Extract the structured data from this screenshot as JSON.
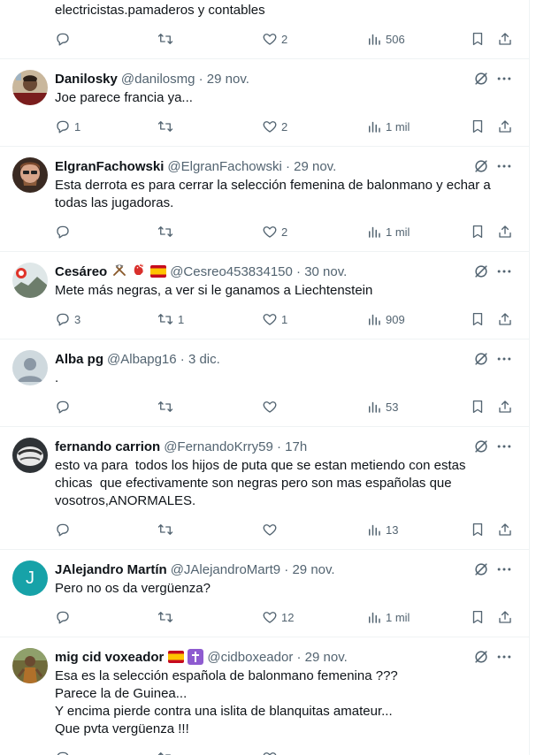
{
  "tweets": [
    {
      "text": "electricistas.pamaderos y contables",
      "counts": {
        "replies": "",
        "retweets": "",
        "likes": "2",
        "views": "506"
      }
    },
    {
      "name": "Danilosky",
      "handle": "@danilosmg · 29 nov.",
      "text": "Joe parece francia ya...",
      "counts": {
        "replies": "1",
        "retweets": "",
        "likes": "2",
        "views": "1 mil"
      }
    },
    {
      "name": "ElgranFachowski",
      "handle": "@ElgranFachowski · 29 nov.",
      "text": "Esta derrota es para cerrar la selección femenina de balonmano y echar a\ntodas las jugadoras.",
      "counts": {
        "replies": "",
        "retweets": "",
        "likes": "2",
        "views": "1 mil"
      }
    },
    {
      "name": "Cesáreo",
      "handle": "@Cesreo453834150 · 30 nov.",
      "text": "Mete más negras, a ver si le ganamos a Liechtenstein",
      "counts": {
        "replies": "3",
        "retweets": "1",
        "likes": "1",
        "views": "909"
      }
    },
    {
      "name": "Alba pg",
      "handle": "@Albapg16 · 3 dic.",
      "text": ".",
      "counts": {
        "replies": "",
        "retweets": "",
        "likes": "",
        "views": "53"
      }
    },
    {
      "name": "fernando carrion",
      "handle": "@FernandoKrry59 · 17h",
      "text": "esto va para  todos los hijos de puta que se estan metiendo con estas\nchicas  que efectivamente son negras pero son mas españolas que\nvosotros,ANORMALES.",
      "counts": {
        "replies": "",
        "retweets": "",
        "likes": "",
        "views": "13"
      }
    },
    {
      "name": "JAlejandro Martín",
      "handle": "@JAlejandroMart9 · 29 nov.",
      "avatar_letter": "J",
      "text": "Pero no os da vergüenza?",
      "counts": {
        "replies": "",
        "retweets": "",
        "likes": "12",
        "views": "1 mil"
      }
    },
    {
      "name": "mig cid voxeador",
      "handle": "@cidboxeador · 29 nov.",
      "text": "Esa es la selección española de balonmano femenina ???\nParece la de Guinea...\nY encima pierde contra una islita de blanquitas amateur...\nQue pvta vergüenza !!!",
      "counts": {
        "replies": "",
        "retweets": "",
        "likes": "",
        "views": ""
      }
    }
  ],
  "colors": {
    "text": "#0f1419",
    "secondary": "#536471",
    "divider": "#eff3f4",
    "avatar_teal": "#17a2a8"
  }
}
